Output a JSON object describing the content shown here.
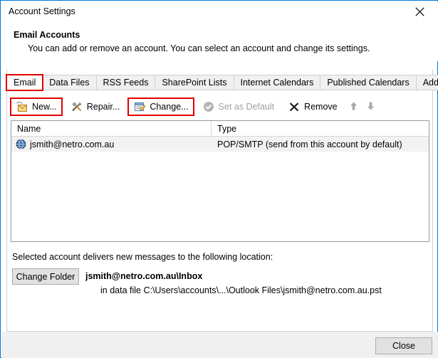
{
  "window": {
    "title": "Account Settings",
    "close_icon": "close-x-icon"
  },
  "header": {
    "title": "Email Accounts",
    "subtitle": "You can add or remove an account. You can select an account and change its settings."
  },
  "tabs": [
    {
      "label": "Email",
      "active": true,
      "highlighted": true
    },
    {
      "label": "Data Files",
      "active": false,
      "highlighted": false
    },
    {
      "label": "RSS Feeds",
      "active": false,
      "highlighted": false
    },
    {
      "label": "SharePoint Lists",
      "active": false,
      "highlighted": false
    },
    {
      "label": "Internet Calendars",
      "active": false,
      "highlighted": false
    },
    {
      "label": "Published Calendars",
      "active": false,
      "highlighted": false
    },
    {
      "label": "Address Books",
      "active": false,
      "highlighted": false
    }
  ],
  "toolbar": {
    "new_label": "New...",
    "new_icon": "new-mail-icon",
    "repair_label": "Repair...",
    "repair_icon": "repair-tools-icon",
    "change_label": "Change...",
    "change_icon": "change-settings-icon",
    "set_default_label": "Set as Default",
    "set_default_icon": "check-circle-icon",
    "remove_label": "Remove",
    "remove_icon": "remove-x-icon",
    "move_up_icon": "arrow-up-icon",
    "move_down_icon": "arrow-down-icon"
  },
  "accounts_list": {
    "columns": [
      "Name",
      "Type"
    ],
    "rows": [
      {
        "icon": "account-globe-icon",
        "name": "jsmith@netro.com.au",
        "type": "POP/SMTP (send from this account by default)"
      }
    ]
  },
  "delivery": {
    "label": "Selected account delivers new messages to the following location:",
    "change_folder_label": "Change Folder",
    "path": "jsmith@netro.com.au\\Inbox",
    "data_file": "in data file C:\\Users\\accounts\\...\\Outlook Files\\jsmith@netro.com.au.pst"
  },
  "footer": {
    "close_label": "Close"
  },
  "colors": {
    "window_border": "#0078d7",
    "highlight_box": "#e00000",
    "disabled_text": "#a0a0a0",
    "row_selected_bg": "#f2f2f2",
    "footer_bg": "#f0f0f0"
  }
}
